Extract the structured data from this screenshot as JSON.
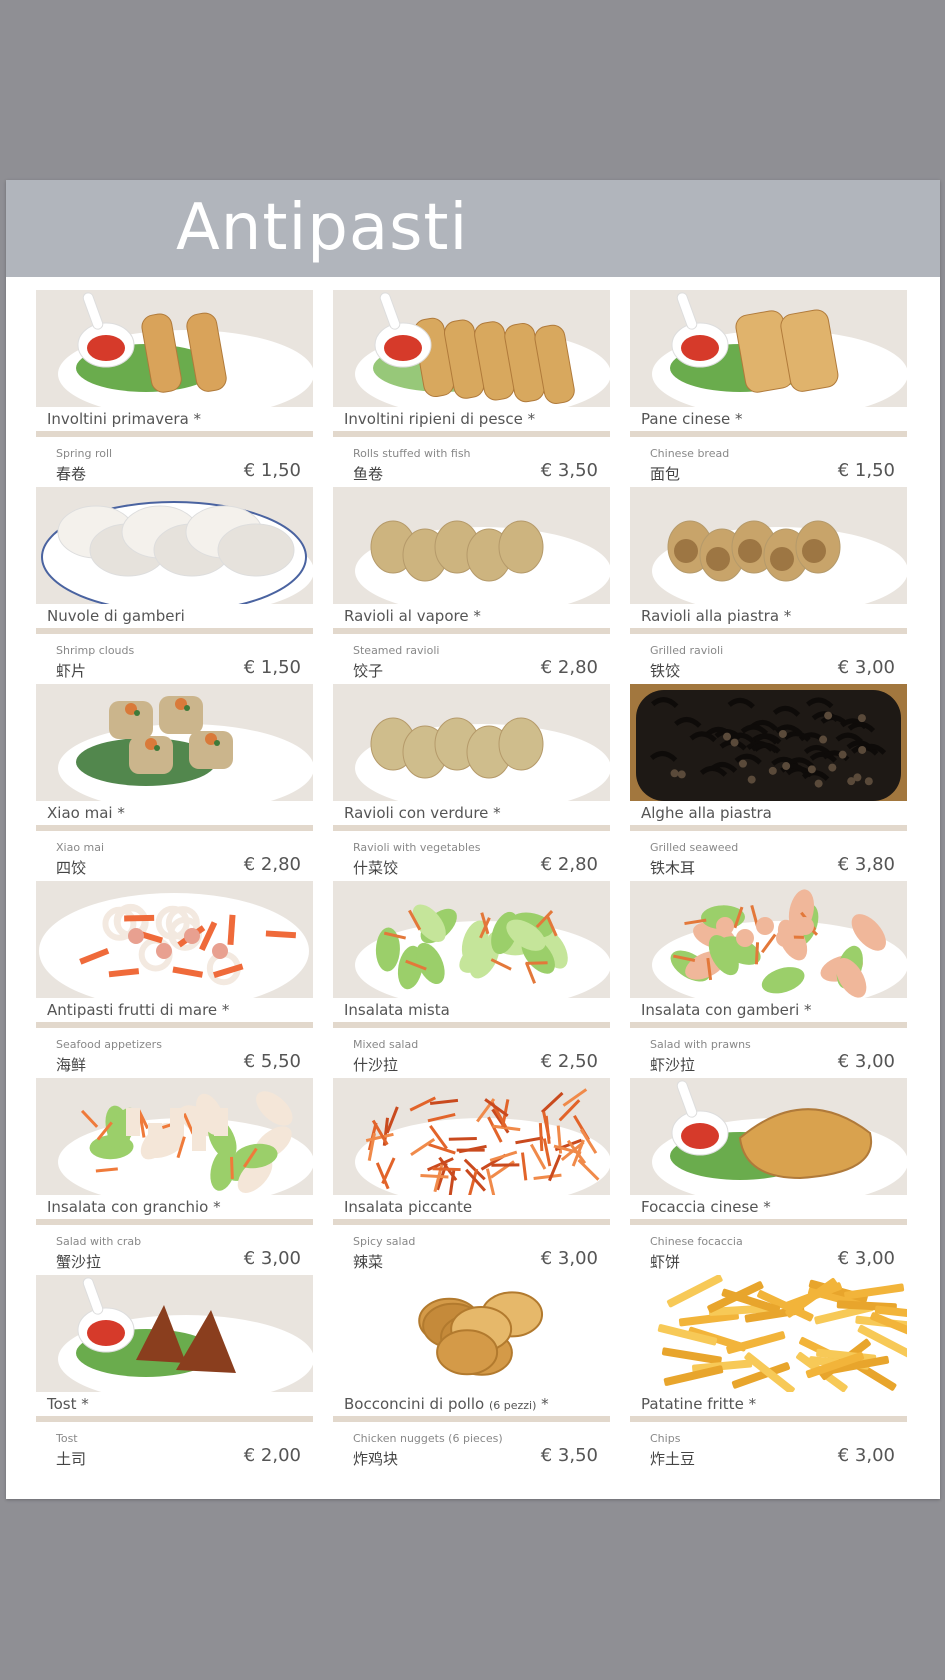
{
  "title": "Antipasti",
  "items": [
    {
      "name": "Involtini primavera *",
      "en": "Spring roll",
      "zh": "春卷",
      "price": "€ 1,50",
      "photo": "spring-roll",
      "colors": [
        "#d9a35a",
        "#5aa33a",
        "#d63a2a"
      ]
    },
    {
      "name": "Involtini ripieni di pesce *",
      "en": "Rolls stuffed with fish",
      "zh": "鱼卷",
      "price": "€ 3,50",
      "photo": "fish-rolls",
      "colors": [
        "#d8a85e",
        "#8cc26a",
        "#d63a2a"
      ]
    },
    {
      "name": "Pane cinese *",
      "en": "Chinese bread",
      "zh": "面包",
      "price": "€ 1,50",
      "photo": "chinese-bread",
      "colors": [
        "#e0b36c",
        "#5aa33a",
        "#d63a2a"
      ]
    },
    {
      "name": "Nuvole di gamberi",
      "en": "Shrimp clouds",
      "zh": "虾片",
      "price": "€ 1,50",
      "photo": "shrimp-crackers",
      "colors": [
        "#f4f1ec",
        "#e6e2dc",
        "#4a63a0"
      ]
    },
    {
      "name": "Ravioli al vapore *",
      "en": "Steamed ravioli",
      "zh": "饺子",
      "price": "€ 2,80",
      "photo": "steamed-dumplings",
      "colors": [
        "#cdb47f",
        "#d6c08e",
        "#ffffff"
      ]
    },
    {
      "name": "Ravioli alla piastra *",
      "en": "Grilled ravioli",
      "zh": "铁饺",
      "price": "€ 3,00",
      "photo": "grilled-dumplings",
      "colors": [
        "#c8a46a",
        "#8a6233",
        "#ffffff"
      ]
    },
    {
      "name": "Xiao mai *",
      "en": "Xiao mai",
      "zh": "四饺",
      "price": "€ 2,80",
      "photo": "siu-mai",
      "colors": [
        "#cbb58c",
        "#3f7a3a",
        "#d97a3a"
      ]
    },
    {
      "name": "Ravioli con verdure *",
      "en": "Ravioli with vegetables",
      "zh": "什菜饺",
      "price": "€ 2,80",
      "photo": "veg-dumplings",
      "colors": [
        "#cfbd8c",
        "#d8c79a",
        "#ffffff"
      ]
    },
    {
      "name": "Alghe alla piastra",
      "en": "Grilled seaweed",
      "zh": "铁木耳",
      "price": "€ 3,80",
      "photo": "grilled-seaweed",
      "colors": [
        "#1e1915",
        "#3a2f25",
        "#5a4a3a"
      ]
    },
    {
      "name": "Antipasti frutti di mare *",
      "en": "Seafood appetizers",
      "zh": "海鲜",
      "price": "€ 5,50",
      "photo": "seafood",
      "colors": [
        "#ef6a3a",
        "#f3e9e0",
        "#e8a090"
      ]
    },
    {
      "name": "Insalata mista",
      "en": "Mixed salad",
      "zh": "什沙拉",
      "price": "€ 2,50",
      "photo": "mixed-salad",
      "colors": [
        "#9bcf6a",
        "#c5e59a",
        "#e3783a"
      ]
    },
    {
      "name": "Insalata con gamberi *",
      "en": "Salad with prawns",
      "zh": "虾沙拉",
      "price": "€ 3,00",
      "photo": "prawn-salad",
      "colors": [
        "#9bcf6a",
        "#f0b79a",
        "#e3783a"
      ]
    },
    {
      "name": "Insalata con granchio *",
      "en": "Salad with crab",
      "zh": "蟹沙拉",
      "price": "€ 3,00",
      "photo": "crab-salad",
      "colors": [
        "#9bcf6a",
        "#f4e6d8",
        "#ef7a3a"
      ]
    },
    {
      "name": "Insalata piccante",
      "en": "Spicy salad",
      "zh": "辣菜",
      "price": "€ 3,00",
      "photo": "spicy-salad",
      "colors": [
        "#e2642a",
        "#c94a1e",
        "#f08a4a"
      ]
    },
    {
      "name": "Focaccia cinese *",
      "en": "Chinese focaccia",
      "zh": "虾饼",
      "price": "€ 3,00",
      "photo": "chinese-focaccia",
      "colors": [
        "#d9a24e",
        "#5aa33a",
        "#d63a2a"
      ]
    },
    {
      "name": "Tost *",
      "en": "Tost",
      "zh": "土司",
      "price": "€ 2,00",
      "photo": "toast",
      "colors": [
        "#8a3e1e",
        "#5aa33a",
        "#d63a2a"
      ]
    },
    {
      "name": "Bocconcini di pollo",
      "name_small": "(6 pezzi)",
      "name_suffix": " *",
      "en": "Chicken nuggets (6 pieces)",
      "zh": "炸鸡块",
      "price": "€ 3,50",
      "photo": "chicken-nuggets",
      "colors": [
        "#d49a48",
        "#c58a3a",
        "#e6b86a"
      ]
    },
    {
      "name": "Patatine fritte *",
      "en": "Chips",
      "zh": "炸土豆",
      "price": "€ 3,00",
      "photo": "fries",
      "colors": [
        "#f2b43a",
        "#f7c957",
        "#e8a52c"
      ]
    }
  ]
}
